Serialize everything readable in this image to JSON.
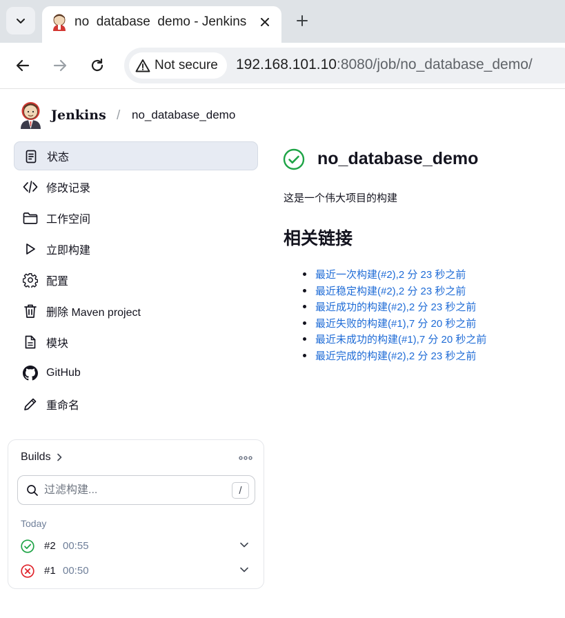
{
  "browser": {
    "tab_title": "no  database  demo - Jenkins",
    "security_label": "Not secure",
    "url_host": "192.168.101.10",
    "url_rest": ":8080/job/no_database_demo/"
  },
  "header": {
    "brand": "Jenkins",
    "breadcrumb_separator": "/",
    "breadcrumb_job": "no_database_demo"
  },
  "sidebar": {
    "items": [
      {
        "label": "状态",
        "icon": "status-document-icon"
      },
      {
        "label": "修改记录",
        "icon": "code-icon"
      },
      {
        "label": "工作空间",
        "icon": "folder-icon"
      },
      {
        "label": "立即构建",
        "icon": "play-icon"
      },
      {
        "label": "配置",
        "icon": "gear-icon"
      },
      {
        "label": "删除 Maven project",
        "icon": "trash-icon"
      },
      {
        "label": "模块",
        "icon": "document-icon"
      },
      {
        "label": "GitHub",
        "icon": "github-icon"
      },
      {
        "label": "重命名",
        "icon": "pencil-icon"
      }
    ]
  },
  "builds": {
    "title": "Builds",
    "filter_placeholder": "过滤构建...",
    "filter_shortcut": "/",
    "group_label": "Today",
    "rows": [
      {
        "number": "#2",
        "time": "00:55",
        "status": "success"
      },
      {
        "number": "#1",
        "time": "00:50",
        "status": "failed"
      }
    ]
  },
  "main": {
    "title": "no_database_demo",
    "description": "这是一个伟大项目的构建",
    "permalinks_heading": "相关链接",
    "permalinks": [
      "最近一次构建(#2),2 分 23 秒之前",
      "最近稳定构建(#2),2 分 23 秒之前",
      "最近成功的构建(#2),2 分 23 秒之前",
      "最近失败的构建(#1),7 分 20 秒之前",
      "最近未成功的构建(#1),7 分 20 秒之前",
      "最近完成的构建(#2),2 分 23 秒之前"
    ]
  },
  "colors": {
    "success": "#1ea446",
    "failure": "#e0242c",
    "link": "#1e6bd6",
    "active_item_bg": "#e7ebf3"
  }
}
